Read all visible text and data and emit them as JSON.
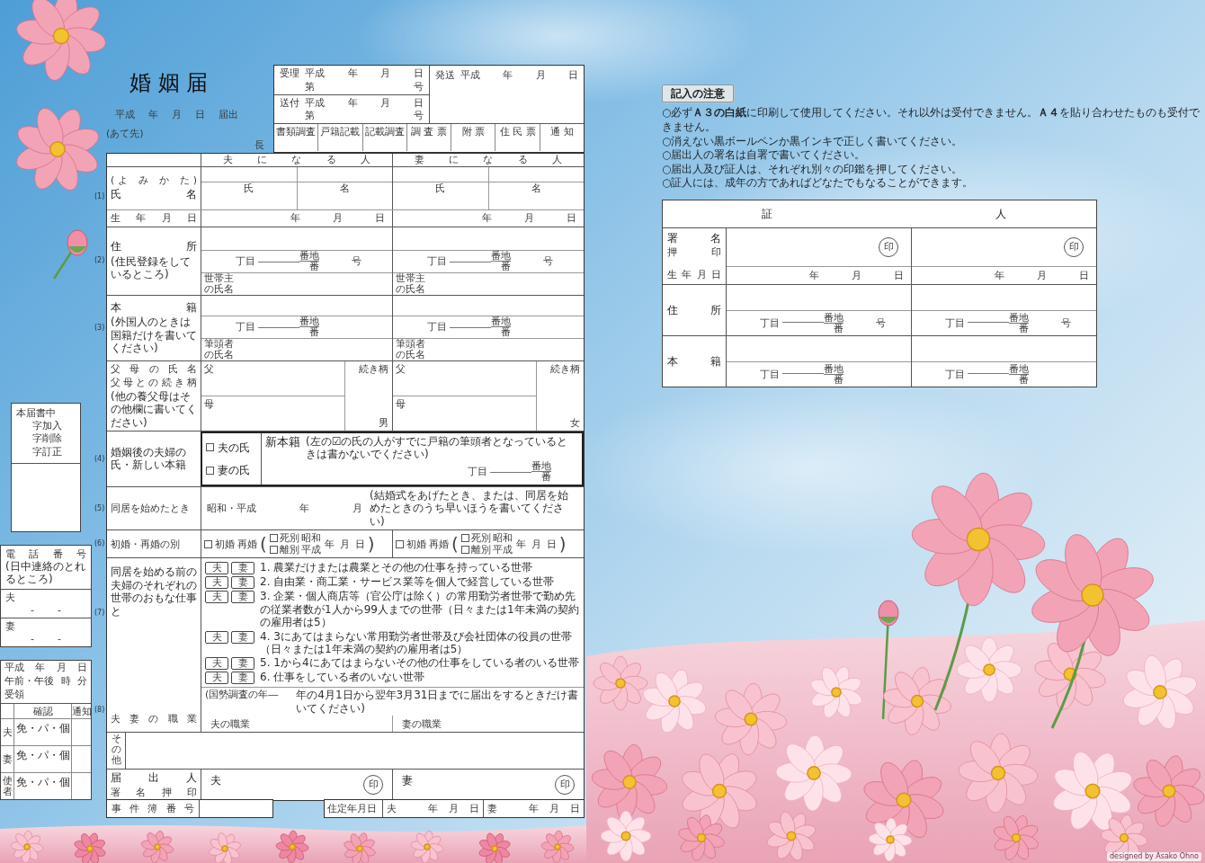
{
  "title": "婚 姻 届",
  "filing": {
    "date": [
      "平成",
      "年",
      "月",
      "日",
      "届出"
    ],
    "addressee": "(あて先)",
    "office_suffix": "長"
  },
  "office": {
    "received": {
      "label": "受理",
      "era": "平成",
      "date": [
        "年",
        "月",
        "日"
      ],
      "number": [
        "第",
        "号"
      ]
    },
    "sent": {
      "label": "送付",
      "era": "平成",
      "date": [
        "年",
        "月",
        "日"
      ],
      "number": [
        "第",
        "号"
      ]
    },
    "dispatched": {
      "label": "発送",
      "era": "平成",
      "date": [
        "年",
        "月",
        "日"
      ]
    },
    "stamps": [
      "書類調査",
      "戸籍記載",
      "記載調査",
      "調 査 票",
      "附 票",
      "住 民 票",
      "通 知"
    ]
  },
  "persons": [
    "夫 に な る 人",
    "妻 に な る 人"
  ],
  "name_section": {
    "marker": "(1)",
    "reading_label": "(よ み か た)",
    "name_label": "氏 名",
    "birth_label": "生 年 月 日",
    "columns": [
      {
        "surname": "氏",
        "given_name": "名",
        "birth": [
          "年",
          "月",
          "日"
        ]
      },
      {
        "surname": "氏",
        "given_name": "名",
        "birth": [
          "年",
          "月",
          "日"
        ]
      }
    ]
  },
  "address_section": {
    "marker": "(2)",
    "label": "住 所",
    "note": "(住民登録をしているところ)",
    "columns": [
      {
        "number": [
          "丁目",
          "番地",
          "番",
          "号"
        ],
        "householder": "世帯主の氏名"
      },
      {
        "number": [
          "丁目",
          "番地",
          "番",
          "号"
        ],
        "householder": "世帯主の氏名"
      }
    ]
  },
  "domicile_section": {
    "marker": "(3)",
    "label": "本 籍",
    "note": "(外国人のときは国籍だけを書いてください)",
    "columns": [
      {
        "number": [
          "丁目",
          "番地",
          "番"
        ],
        "head": "筆頭者の氏名"
      },
      {
        "number": [
          "丁目",
          "番地",
          "番"
        ],
        "head": "筆頭者の氏名"
      }
    ]
  },
  "parents_section": {
    "labels": [
      "父母の氏名",
      "父母との続き柄"
    ],
    "note": "(他の養父母はその他欄に書いてください)",
    "columns": [
      {
        "father": "父",
        "mother": "母",
        "relation": "続き柄",
        "sex": "男"
      },
      {
        "father": "父",
        "mother": "母",
        "relation": "続き柄",
        "sex": "女"
      }
    ]
  },
  "surname_section": {
    "marker": "(4)",
    "label": "婚姻後の夫婦の氏・新しい本籍",
    "options": [
      {
        "label": "夫の氏",
        "checked": false
      },
      {
        "label": "妻の氏",
        "checked": false
      }
    ],
    "domicile_label": "新本籍",
    "note": "(左の☑の氏の人がすでに戸籍の筆頭者となっているときは書かないでください)",
    "number": [
      "丁目",
      "番地",
      "番"
    ]
  },
  "cohabitation_section": {
    "marker": "(5)",
    "label": "同居を始めたとき",
    "era": "昭和・平成",
    "date": [
      "年",
      "月"
    ],
    "note": "(結婚式をあげたとき、または、同居を始めたときのうち早いほうを書いてください)"
  },
  "marriage_history_section": {
    "marker": "(6)",
    "label": "初婚・再婚の別",
    "columns": [
      {
        "first": {
          "label": "初婚",
          "checked": false
        },
        "remarriage": "再婚",
        "brackets": [
          "(",
          ")"
        ],
        "reasons": [
          {
            "label": "死別",
            "era": "昭和",
            "checked": false
          },
          {
            "label": "離別",
            "era": "平成",
            "checked": false
          }
        ],
        "date": [
          "年",
          "月",
          "日"
        ]
      },
      {
        "first": {
          "label": "初婚",
          "checked": false
        },
        "remarriage": "再婚",
        "brackets": [
          "(",
          ")"
        ],
        "reasons": [
          {
            "label": "死別",
            "era": "昭和",
            "checked": false
          },
          {
            "label": "離別",
            "era": "平成",
            "checked": false
          }
        ],
        "date": [
          "年",
          "月",
          "日"
        ]
      }
    ]
  },
  "occupation_section": {
    "markers": [
      "(7)",
      "(8)"
    ],
    "label": "同居を始める前の夫婦のそれぞれの世帯のおもな仕事と",
    "job_label": "夫 妻 の 職 業",
    "items": [
      {
        "husband": {
          "label": "夫",
          "checked": false
        },
        "wife": {
          "label": "妻",
          "checked": false
        },
        "text": "1. 農業だけまたは農業とその他の仕事を持っている世帯"
      },
      {
        "husband": {
          "label": "夫",
          "checked": false
        },
        "wife": {
          "label": "妻",
          "checked": false
        },
        "text": "2. 自由業・商工業・サービス業等を個人で経営している世帯"
      },
      {
        "husband": {
          "label": "夫",
          "checked": false
        },
        "wife": {
          "label": "妻",
          "checked": false
        },
        "text": "3. 企業・個人商店等（官公庁は除く）の常用勤労者世帯で勤め先の従業者数が1人から99人までの世帯（日々または1年未満の契約の雇用者は5）"
      },
      {
        "husband": {
          "label": "夫",
          "checked": false
        },
        "wife": {
          "label": "妻",
          "checked": false
        },
        "text": "4. 3にあてはまらない常用勤労者世帯及び会社団体の役員の世帯（日々または1年未満の契約の雇用者は5）"
      },
      {
        "husband": {
          "label": "夫",
          "checked": false
        },
        "wife": {
          "label": "妻",
          "checked": false
        },
        "text": "5. 1から4にあてはまらないその他の仕事をしている者のいる世帯"
      },
      {
        "husband": {
          "label": "夫",
          "checked": false
        },
        "wife": {
          "label": "妻",
          "checked": false
        },
        "text": "6. 仕事をしている者のいない世帯"
      }
    ],
    "job_note": [
      "(国勢調査の年―",
      "年の4月1日から翌年3月31日までに届出をするときだけ書いてください)"
    ],
    "jobs": [
      "夫の職業",
      "妻の職業"
    ]
  },
  "other_section": {
    "label": "その他"
  },
  "signature_section": {
    "labels": [
      "届 出 人",
      "署 名 押 印"
    ],
    "columns": [
      {
        "label": "夫",
        "seal": "印"
      },
      {
        "label": "妻",
        "seal": "印"
      }
    ]
  },
  "footer": {
    "case_label": "事 件 簿 番 号",
    "date_label": "住定年月日",
    "columns": [
      {
        "label": "夫",
        "date": [
          "年",
          "月",
          "日"
        ]
      },
      {
        "label": "妻",
        "date": [
          "年",
          "月",
          "日"
        ]
      }
    ]
  },
  "correction_box": [
    "本届書中",
    "字加入",
    "字削除",
    "字訂正"
  ],
  "phone_box": {
    "title": "電 話 番 号",
    "note": "(日中連絡のとれるところ)",
    "rows": [
      {
        "label": "夫",
        "separators": [
          "-",
          "-"
        ]
      },
      {
        "label": "妻",
        "separators": [
          "-",
          "-"
        ]
      }
    ]
  },
  "receipt_box": {
    "date": [
      "平成",
      "年",
      "月",
      "日"
    ],
    "time": [
      "午前・午後",
      "時",
      "分"
    ],
    "received": "受領",
    "headers": [
      "確認",
      "通知"
    ],
    "rows": [
      {
        "label": "夫",
        "documents": "免・パ・個"
      },
      {
        "label": "妻",
        "documents": "免・パ・個"
      },
      {
        "label": "使者",
        "documents": "免・パ・個"
      }
    ]
  },
  "notes": {
    "title": "記入の注意",
    "items": [
      "○必ず**Ａ３の白紙**に印刷して使用してください。それ以外は受付できません。**Ａ４**を貼り合わせたものも受付できません。",
      "○消えない黒ボールペンか黒インキで正しく書いてください。",
      "○届出人の署名は自署で書いてください。",
      "○届出人及び証人は、それぞれ別々の印鑑を押してください。",
      "○証人には、成年の方であればどなたでもなることができます。"
    ]
  },
  "witnesses": {
    "title": "証 人",
    "sign_label": "署 名",
    "seal_label": "押 印",
    "birth_label": "生 年 月 日",
    "address_label": "住 所",
    "domicile_label": "本 籍",
    "columns": [
      {
        "seal": "印",
        "birth": [
          "年",
          "月",
          "日"
        ],
        "address_number": [
          "丁目",
          "番地",
          "番",
          "号"
        ],
        "domicile_number": [
          "丁目",
          "番地",
          "番"
        ]
      },
      {
        "seal": "印",
        "birth": [
          "年",
          "月",
          "日"
        ],
        "address_number": [
          "丁目",
          "番地",
          "番",
          "号"
        ],
        "domicile_number": [
          "丁目",
          "番地",
          "番"
        ]
      }
    ]
  },
  "credit": "designed by Asako Ohno"
}
